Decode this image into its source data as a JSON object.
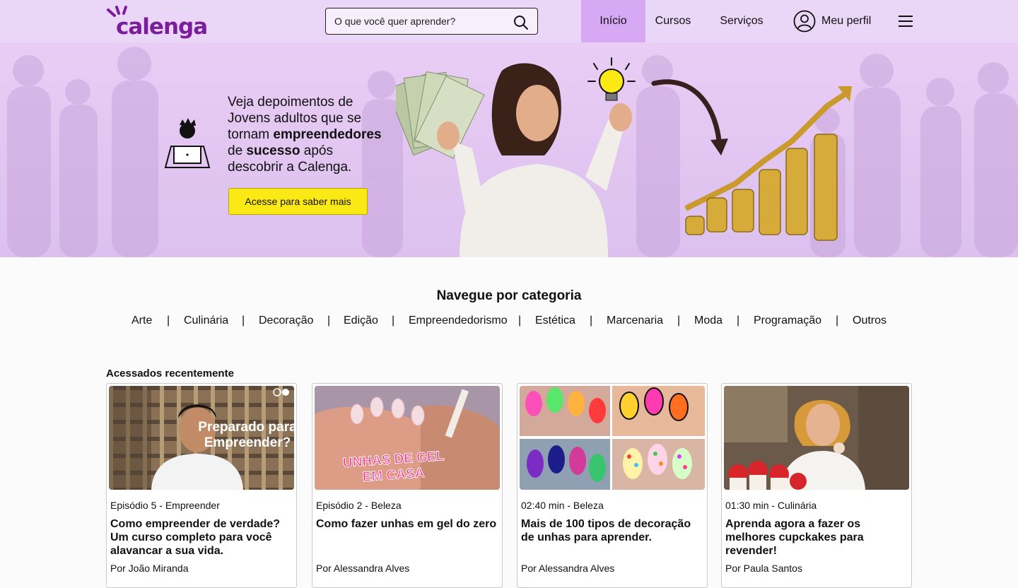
{
  "header": {
    "logo_text": "calenga",
    "search_placeholder": "O que você quer aprender?",
    "nav": [
      "Início",
      "Cursos",
      "Serviços"
    ],
    "profile_label": "Meu perfil",
    "colors": {
      "header_bg": "#ead6f6",
      "active_tab": "#d7a8f3",
      "brand": "#7a1e9c"
    }
  },
  "hero": {
    "line1": "Veja depoimentos de",
    "line2": "Jovens adultos que se",
    "line3_prefix": "tornam ",
    "line3_bold": "empreendedores",
    "line4_prefix": "de ",
    "line4_bold": "sucesso",
    "line4_suffix": " após",
    "line5": "descobrir a Calenga.",
    "cta_label": "Acesse para saber mais",
    "cta_color": "#fbe915"
  },
  "categories": {
    "title": "Navegue por categoria",
    "items": [
      "Arte",
      "Culinária",
      "Decoração",
      "Edição",
      "Empreendedorismo",
      "Estética",
      "Marcenaria",
      "Moda",
      "Programação",
      "Outros"
    ],
    "separator": "|"
  },
  "recent": {
    "title": "Acessados recentemente",
    "cards": [
      {
        "meta": "Episódio 5 - Empreender",
        "title": "Como empreender de verdade? Um curso completo para você alavancar a sua vida.",
        "author": "Por João Miranda",
        "thumb_text": "Preparado para Empreender?"
      },
      {
        "meta": "Episódio 2 - Beleza",
        "title": "Como fazer unhas em gel do zero",
        "author": "Por Alessandra Alves",
        "thumb_text": "UNHAS DE GEL EM CASA"
      },
      {
        "meta": "02:40 min - Beleza",
        "title": "Mais de 100 tipos de decoração de unhas para aprender.",
        "author": "Por Alessandra Alves",
        "thumb_text": ""
      },
      {
        "meta": "01:30 min - Culinária",
        "title": "Aprenda agora a fazer os melhores cupckakes para revender!",
        "author": "Por Paula Santos",
        "thumb_text": ""
      }
    ]
  }
}
